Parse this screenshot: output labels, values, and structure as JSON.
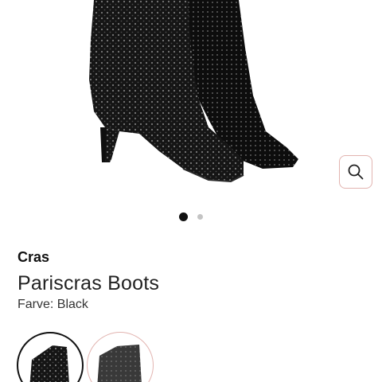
{
  "product": {
    "brand": "Cras",
    "name": "Pariscras Boots",
    "color_label": "Farve: Black"
  },
  "gallery": {
    "image_count": 2,
    "active_index": 0,
    "zoom_icon": "search-icon"
  },
  "swatches": [
    {
      "color": "#111111",
      "selected": true
    },
    {
      "color": "#6f6f6f",
      "selected": false
    }
  ],
  "colors": {
    "accent_border": "#e2b4b0",
    "text": "#1a1a1a",
    "active_dot": "#111111",
    "inactive_dot": "#c4c4c4"
  }
}
